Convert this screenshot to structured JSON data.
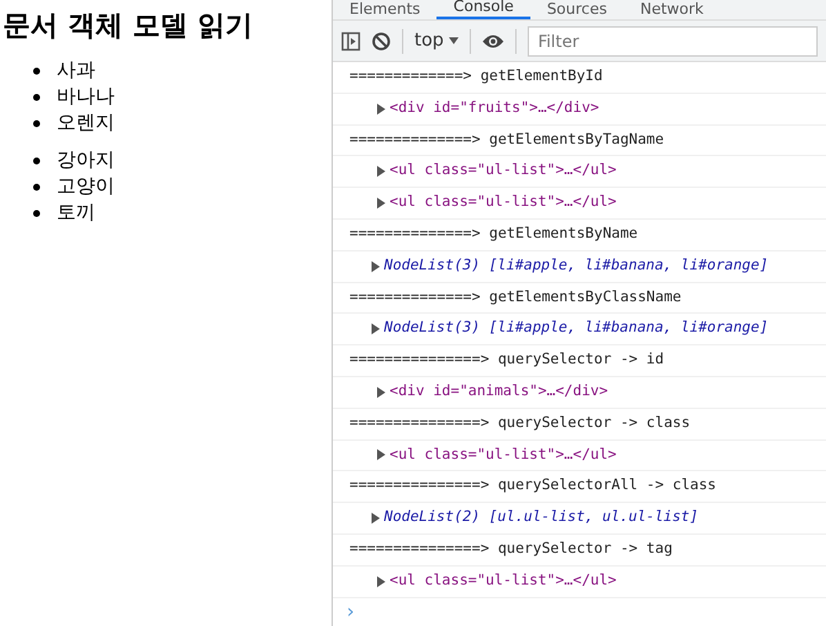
{
  "page": {
    "heading": "문서 객체 모델 읽기",
    "lists": [
      {
        "items": [
          "사과",
          "바나나",
          "오렌지"
        ]
      },
      {
        "items": [
          "강아지",
          "고양이",
          "토끼"
        ]
      }
    ]
  },
  "devtools": {
    "tabs": [
      {
        "label": "Elements",
        "selected": false
      },
      {
        "label": "Console",
        "selected": true
      },
      {
        "label": "Sources",
        "selected": false
      },
      {
        "label": "Network",
        "selected": false
      }
    ],
    "context": "top",
    "filter": {
      "placeholder": "Filter"
    },
    "console": [
      {
        "kind": "log",
        "text": "=============> getElementById"
      },
      {
        "kind": "element",
        "text": "<div id=\"fruits\">…</div>",
        "expanded": false
      },
      {
        "kind": "log",
        "text": "==============> getElementsByTagName"
      },
      {
        "kind": "element",
        "text": "<ul class=\"ul-list\">…</ul>",
        "expanded": false
      },
      {
        "kind": "element",
        "text": "<ul class=\"ul-list\">…</ul>",
        "expanded": false
      },
      {
        "kind": "log",
        "text": "==============> getElementsByName"
      },
      {
        "kind": "nodelist",
        "text": "NodeList(3) [li#apple, li#banana, li#orange]",
        "expanded": false
      },
      {
        "kind": "log",
        "text": "==============> getElementsByClassName"
      },
      {
        "kind": "nodelist",
        "text": "NodeList(3) [li#apple, li#banana, li#orange]",
        "expanded": false
      },
      {
        "kind": "log",
        "text": "===============> querySelector -> id"
      },
      {
        "kind": "element",
        "text": "<div id=\"animals\">…</div>",
        "expanded": false
      },
      {
        "kind": "log",
        "text": "===============> querySelector -> class"
      },
      {
        "kind": "element",
        "text": "<ul class=\"ul-list\">…</ul>",
        "expanded": false
      },
      {
        "kind": "log",
        "text": "===============> querySelectorAll -> class"
      },
      {
        "kind": "nodelist",
        "text": "NodeList(2) [ul.ul-list, ul.ul-list]",
        "expanded": false
      },
      {
        "kind": "log",
        "text": "===============> querySelector -> tag"
      },
      {
        "kind": "element",
        "text": "<ul class=\"ul-list\">…</ul>",
        "expanded": false
      }
    ],
    "prompt": "›"
  }
}
